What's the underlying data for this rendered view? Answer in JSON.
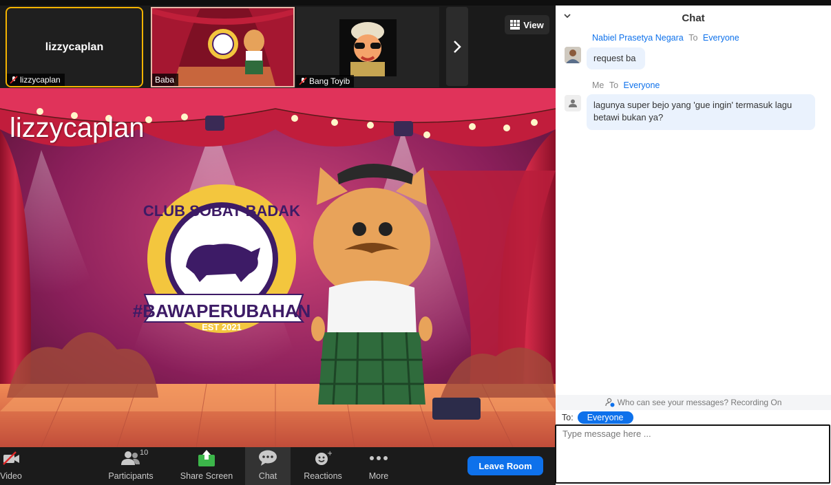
{
  "thumbnails": [
    {
      "name": "lizzycaplan",
      "display_text": "lizzycaplan",
      "muted": true,
      "active": true
    },
    {
      "name": "Baba",
      "muted": false
    },
    {
      "name": "Bang Toyib",
      "muted": true
    }
  ],
  "view_button": {
    "label": "View",
    "icon": "grid-icon"
  },
  "main_video": {
    "speaker_name": "lizzycaplan",
    "logo_text_top": "CLUB SOBAT BADAK",
    "logo_banner": "#BAWAPERUBAHAN",
    "logo_est": "EST 2021"
  },
  "toolbar": {
    "video_label": "Video",
    "participants_label": "Participants",
    "participants_count": "10",
    "share_label": "Share Screen",
    "chat_label": "Chat",
    "reactions_label": "Reactions",
    "more_label": "More",
    "leave_label": "Leave Room"
  },
  "chat": {
    "title": "Chat",
    "messages": [
      {
        "sender": "Nabiel Prasetya Negara",
        "to_word": "To",
        "target": "Everyone",
        "text": "request ba"
      },
      {
        "sender": "Me",
        "to_word": "To",
        "target": "Everyone",
        "text": "lagunya super bejo  yang 'gue ingin' termasuk lagu betawi bukan ya?"
      }
    ],
    "privacy_note": "Who can see your messages? Recording On",
    "to_label": "To:",
    "to_target": "Everyone",
    "input_placeholder": "Type message here ..."
  },
  "colors": {
    "accent_blue": "#0e71eb",
    "active_border": "#f5b400",
    "bubble_bg": "#eaf2fd",
    "toolbar_bg": "#1b1b1b"
  }
}
